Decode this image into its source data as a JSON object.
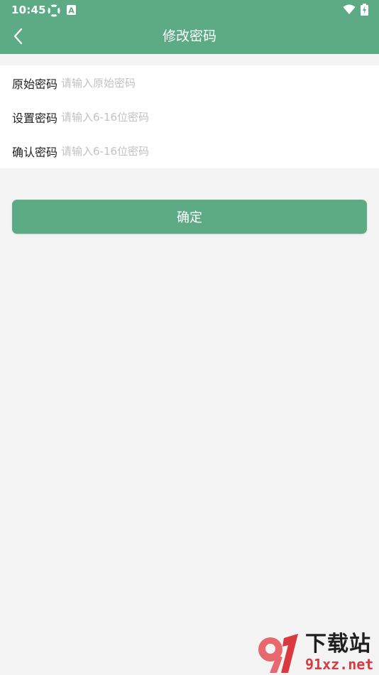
{
  "status_bar": {
    "time": "10:45",
    "icons": [
      "sync-icon",
      "a-badge-icon",
      "wifi-icon",
      "battery-icon"
    ],
    "a_badge": "A"
  },
  "header": {
    "title": "修改密码",
    "back_icon": "chevron-left-icon"
  },
  "form": {
    "fields": [
      {
        "label": "原始密码",
        "value": "",
        "placeholder": "请输入原始密码"
      },
      {
        "label": "设置密码",
        "value": "",
        "placeholder": "请输入6-16位密码"
      },
      {
        "label": "确认密码",
        "value": "",
        "placeholder": "请输入6-16位密码"
      }
    ]
  },
  "confirm_button": {
    "label": "确定"
  },
  "watermark": {
    "title": "下载站",
    "url": "91xz.net",
    "logo_icon": "91-logo-icon"
  },
  "colors": {
    "accent": "#5dab85",
    "background": "#f4f4f4",
    "card": "#ffffff",
    "placeholder": "#c2c2c2"
  }
}
